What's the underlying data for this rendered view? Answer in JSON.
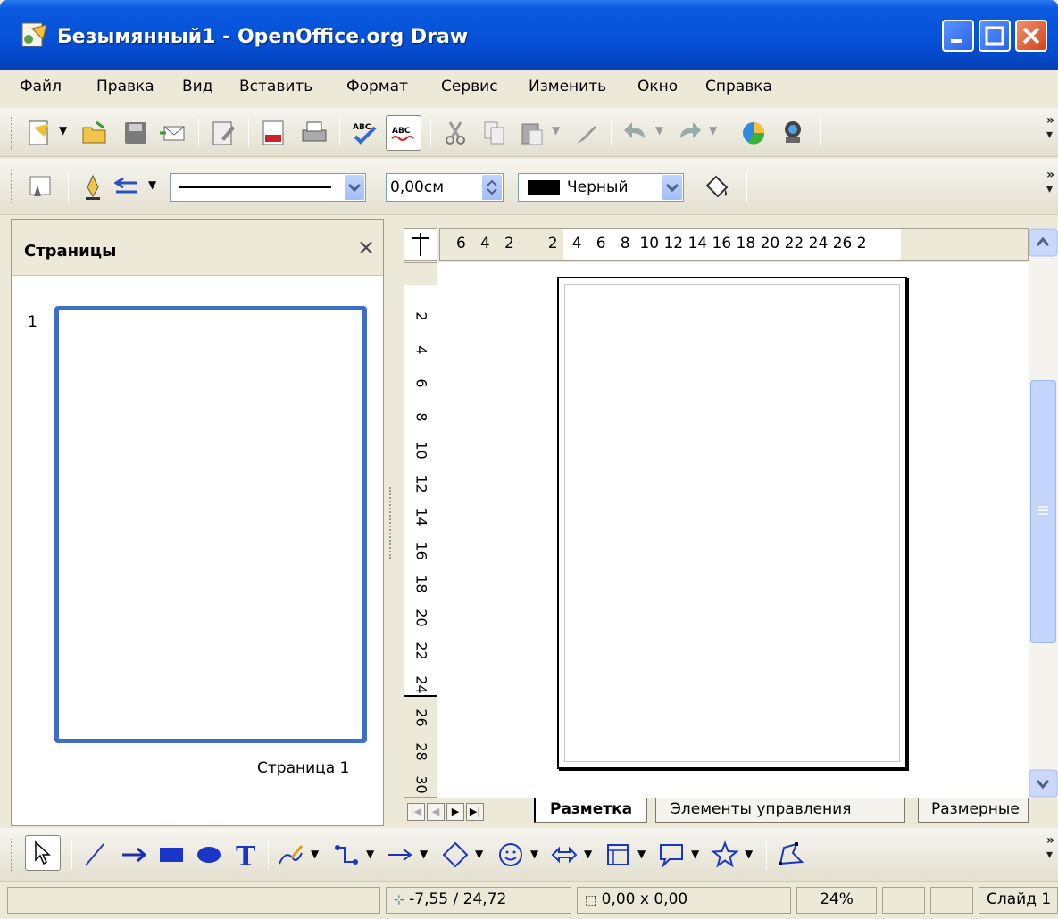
{
  "window": {
    "title": "Безымянный1 - OpenOffice.org Draw"
  },
  "menu": {
    "items": [
      "Файл",
      "Правка",
      "Вид",
      "Вставить",
      "Формат",
      "Сервис",
      "Изменить",
      "Окно",
      "Справка"
    ]
  },
  "line_toolbar": {
    "line_width": "0,00см",
    "line_color": "Черный"
  },
  "sidebar": {
    "title": "Страницы",
    "close": "×",
    "thumbnail_number": "1",
    "thumbnail_label": "Страница 1"
  },
  "rulers": {
    "horizontal": "6   4   2       2   4   6   8  10 12 14 16 18 20 22 24 26 2",
    "vertical": [
      "2",
      "4",
      "6",
      "8",
      "10",
      "12",
      "14",
      "16",
      "18",
      "20",
      "22",
      "24",
      "26",
      "28",
      "30"
    ]
  },
  "tabs": [
    {
      "label": "Разметка",
      "active": true
    },
    {
      "label": "Элементы управления",
      "active": false
    },
    {
      "label": "Размерные",
      "active": false
    }
  ],
  "status": {
    "position": "-7,55 / 24,72",
    "size": "0,00 x 0,00",
    "zoom": "24%",
    "slide": "Слайд 1"
  },
  "colors": {
    "titlebar": "#0a5ae0",
    "selection": "#3d6fc9"
  }
}
